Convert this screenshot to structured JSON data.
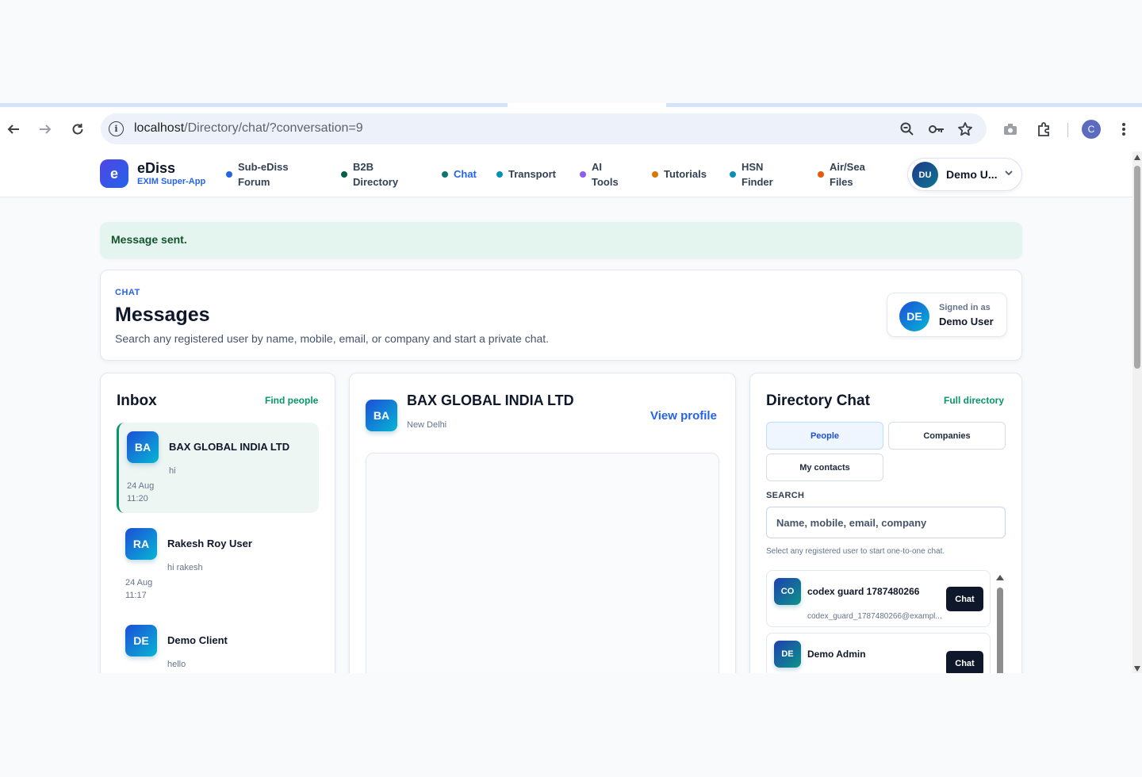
{
  "browser": {
    "url_host": "localhost",
    "url_path": "/Directory/chat/?conversation=9",
    "profile_initial": "C"
  },
  "nav": {
    "logo_letter": "e",
    "brand": "eDiss",
    "tagline": "EXIM Super-App",
    "items": [
      {
        "line1": "Sub-eDiss",
        "line2": "Forum",
        "color": "#2563eb"
      },
      {
        "line1": "B2B",
        "line2": "Directory",
        "color": "#065f46"
      },
      {
        "line1": "Chat",
        "line2": "",
        "color": "#0f766e"
      },
      {
        "line1": "Transport",
        "line2": "",
        "color": "#0891b2"
      },
      {
        "line1": "AI",
        "line2": "Tools",
        "color": "#8b5cf6"
      },
      {
        "line1": "Tutorials",
        "line2": "",
        "color": "#d97706"
      },
      {
        "line1": "HSN",
        "line2": "Finder",
        "color": "#0891b2"
      },
      {
        "line1": "Air/Sea",
        "line2": "Files",
        "color": "#ea580c"
      }
    ],
    "user_initials": "DU",
    "user_name": "Demo U..."
  },
  "alert": {
    "message": "Message sent."
  },
  "header": {
    "eyebrow": "CHAT",
    "title": "Messages",
    "description": "Search any registered user by name, mobile, email, or company and start a private chat.",
    "signed_in_label": "Signed in as",
    "signed_in_name": "Demo User",
    "signed_in_initials": "DE"
  },
  "inbox": {
    "title": "Inbox",
    "link": "Find people",
    "items": [
      {
        "initials": "BA",
        "name": "BAX GLOBAL INDIA LTD",
        "preview": "hi",
        "date": "24 Aug",
        "time": "11:20"
      },
      {
        "initials": "RA",
        "name": "Rakesh Roy User",
        "preview": "hi rakesh",
        "date": "24 Aug",
        "time": "11:17"
      },
      {
        "initials": "DE",
        "name": "Demo Client",
        "preview": "hello",
        "date": "",
        "time": ""
      }
    ]
  },
  "conversation": {
    "initials": "BA",
    "name": "BAX GLOBAL INDIA LTD",
    "location": "New Delhi",
    "view_profile": "View profile"
  },
  "directory": {
    "title": "Directory Chat",
    "link": "Full directory",
    "tabs": [
      "People",
      "Companies",
      "My contacts"
    ],
    "search_label": "SEARCH",
    "search_placeholder": "Name, mobile, email, company",
    "hint": "Select any registered user to start one-to-one chat.",
    "users": [
      {
        "initials": "CO",
        "name": "codex guard 1787480266",
        "email": "codex_guard_1787480266@exampl...",
        "action": "Chat"
      },
      {
        "initials": "DE",
        "name": "Demo Admin",
        "email": "",
        "action": "Chat"
      }
    ]
  }
}
